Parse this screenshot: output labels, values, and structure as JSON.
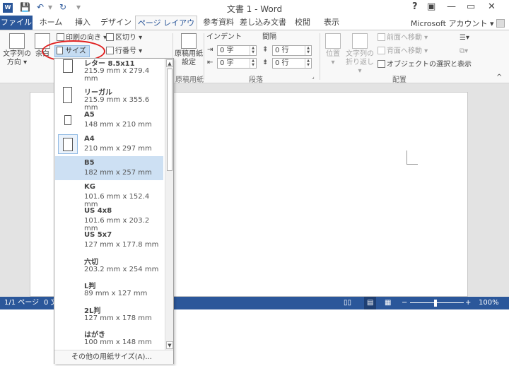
{
  "titlebar": {
    "app_icon": "W",
    "title": "文書 1 - Word",
    "help": "?",
    "minimize": "—",
    "restore": "▭",
    "close": "✕",
    "qat_save": "save-icon",
    "qat_undo": "undo-icon",
    "qat_redo": "redo-icon"
  },
  "tabs": {
    "file": "ファイル",
    "home": "ホーム",
    "insert": "挿入",
    "design": "デザイン",
    "layout": "ページ レイアウト",
    "references": "参考資料",
    "mailings": "差し込み文書",
    "review": "校閲",
    "view": "表示",
    "account": "Microsoft アカウント"
  },
  "ribbon": {
    "text_direction_line1": "文字列の",
    "text_direction_line2": "方向",
    "margins": "余白",
    "orientation": "印刷の向き",
    "breaks": "区切り",
    "size": "サイズ",
    "line_numbers": "行番号",
    "manuscript_line1": "原稿用紙",
    "manuscript_line2": "設定",
    "manuscript_group": "原稿用紙",
    "indent_label": "インデント",
    "spacing_label": "間隔",
    "indent_left": "0 字",
    "indent_right": "0 字",
    "spacing_before": "0 行",
    "spacing_after": "0 行",
    "paragraph_group": "段落",
    "position": "位置",
    "wrap_line1": "文字列の",
    "wrap_line2": "折り返し",
    "bring_forward": "前面へ移動",
    "send_backward": "背面へ移動",
    "selection_pane": "オブジェクトの選択と表示",
    "arrange_group": "配置"
  },
  "statusbar": {
    "page": "1/1 ページ",
    "words": "0 文",
    "zoom": "100%"
  },
  "size_menu": {
    "items": [
      {
        "name": "レター 8.5x11",
        "dims": "215.9 mm x 279.4 mm"
      },
      {
        "name": "リーガル",
        "dims": "215.9 mm x 355.6 mm"
      },
      {
        "name": "A5",
        "dims": "148 mm x 210 mm"
      },
      {
        "name": "A4",
        "dims": "210 mm x 297 mm"
      },
      {
        "name": "B5",
        "dims": "182 mm x 257 mm"
      },
      {
        "name": "KG",
        "dims": "101.6 mm x 152.4 mm"
      },
      {
        "name": "US 4x8",
        "dims": "101.6 mm x 203.2 mm"
      },
      {
        "name": "US 5x7",
        "dims": "127 mm x 177.8 mm"
      },
      {
        "name": "六切",
        "dims": "203.2 mm x 254 mm"
      },
      {
        "name": "L判",
        "dims": "89 mm x 127 mm"
      },
      {
        "name": "2L判",
        "dims": "127 mm x 178 mm"
      },
      {
        "name": "はがき",
        "dims": "100 mm x 148 mm"
      }
    ],
    "footer": "その他の用紙サイズ(A)..."
  }
}
